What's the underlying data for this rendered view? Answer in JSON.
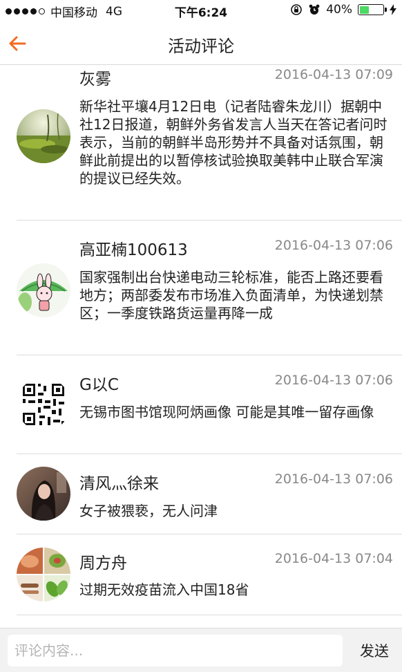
{
  "status_bar": {
    "carrier": "中国移动",
    "network": "4G",
    "time": "下午6:24",
    "battery": "40%",
    "battery_level": 0.4,
    "battery_color": "#4cd964"
  },
  "nav": {
    "title": "活动评论",
    "back_icon": "arrow-left-icon",
    "accent_color": "#f26b21"
  },
  "comments": [
    {
      "name": "灰雾",
      "time": "2016-04-13 07:09",
      "text": "新华社平壤4月12日电（记者陆睿朱龙川）据朝中社12日报道，朝鲜外务省发言人当天在答记者问时表示，当前的朝鲜半岛形势并不具备对话氛围，朝鲜此前提出的以暂停核试验换取美韩中止联合军演的提议已经失效。",
      "avatar": "forest-moss-avatar"
    },
    {
      "name": "高亚楠100613",
      "time": "2016-04-13 07:06",
      "text": "国家强制出台快递电动三轮标准，能否上路还要看地方；两部委发布市场准入负面清单，为快递划禁区；一季度铁路货运量再降一成",
      "avatar": "cartoon-rabbit-avatar"
    },
    {
      "name": "G以C",
      "time": "2016-04-13 07:06",
      "text": "无锡市图书馆现阿炳画像 可能是其唯一留存画像",
      "avatar": "qr-code-avatar"
    },
    {
      "name": "清风灬徐来",
      "time": "2016-04-13 07:06",
      "text": "女子被猥亵，无人问津",
      "avatar": "portrait-photo-avatar"
    },
    {
      "name": "周方舟",
      "time": "2016-04-13 07:04",
      "text": "过期无效疫苗流入中国18省",
      "avatar": "food-collage-avatar"
    }
  ],
  "input_bar": {
    "placeholder": "评论内容...",
    "send_label": "发送"
  }
}
